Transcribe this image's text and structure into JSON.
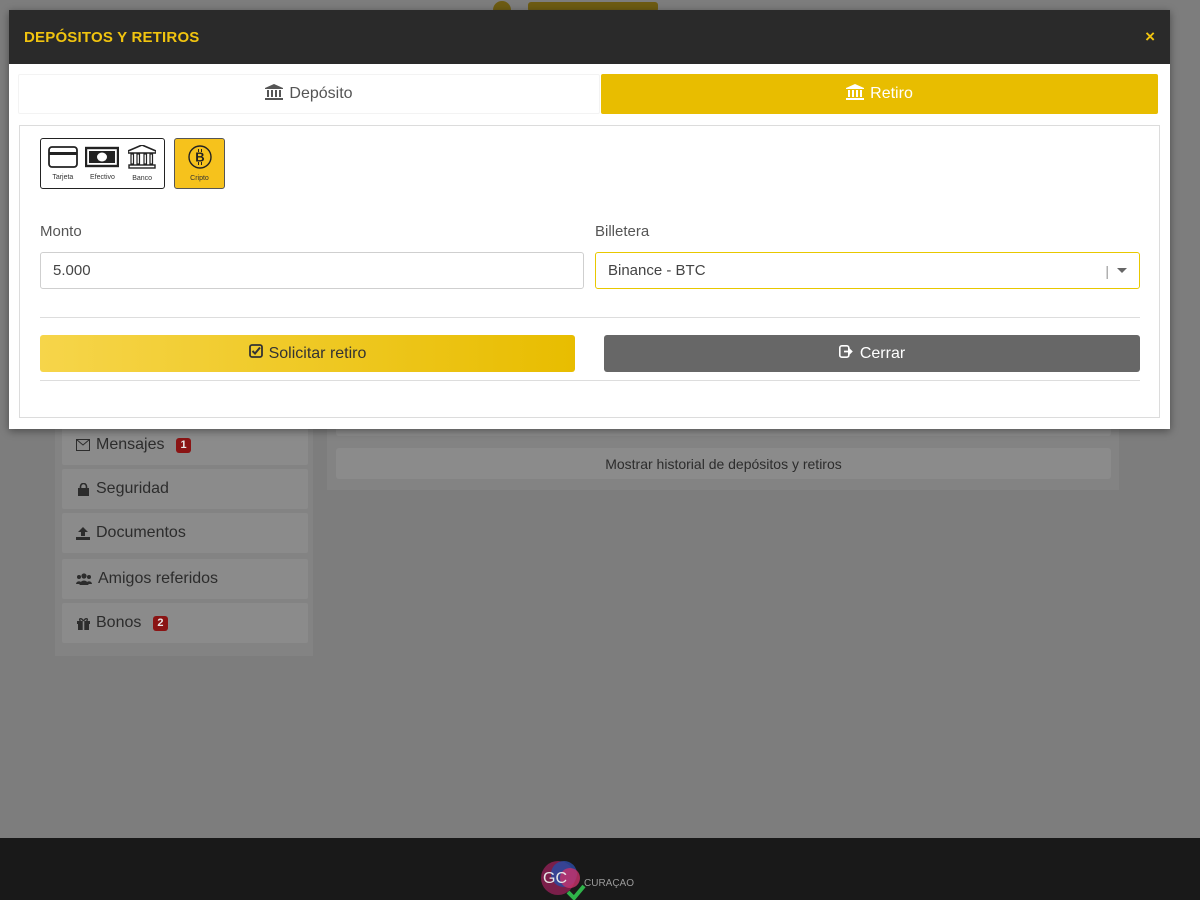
{
  "modal": {
    "title": "DEPÓSITOS Y RETIROS",
    "close_label": "×"
  },
  "tabs": [
    {
      "label": "Depósito",
      "active": false
    },
    {
      "label": "Retiro",
      "active": true
    }
  ],
  "methods": [
    {
      "label": "Tarjeta",
      "icon": "credit-card-icon"
    },
    {
      "label": "Efectivo",
      "icon": "cash-icon"
    },
    {
      "label": "Banco",
      "icon": "bank-icon"
    },
    {
      "label": "Cripto",
      "icon": "bitcoin-icon",
      "selected": true
    }
  ],
  "form": {
    "amount_label": "Monto",
    "amount_value": "5.000",
    "wallet_label": "Billetera",
    "wallet_value": "Binance - BTC"
  },
  "buttons": {
    "request_label": "Solicitar retiro",
    "close_label": "Cerrar"
  },
  "background": {
    "sidebar": [
      {
        "label": "Mensajes",
        "badge": "1",
        "icon": "envelope-icon"
      },
      {
        "label": "Seguridad",
        "icon": "lock-icon"
      },
      {
        "label": "Documentos",
        "icon": "upload-icon"
      },
      {
        "label": "Amigos referidos",
        "icon": "users-icon"
      },
      {
        "label": "Bonos",
        "badge": "2",
        "icon": "gift-icon"
      }
    ],
    "history_button": "Mostrar historial de depósitos y retiros",
    "footer_logo_text": "GC",
    "footer_logo_sub": "CURAÇAO"
  },
  "colors": {
    "accent": "#e8bd00",
    "header_bg": "#2a2a2a",
    "title": "#f1c40f",
    "close_btn_bg": "#676767"
  }
}
